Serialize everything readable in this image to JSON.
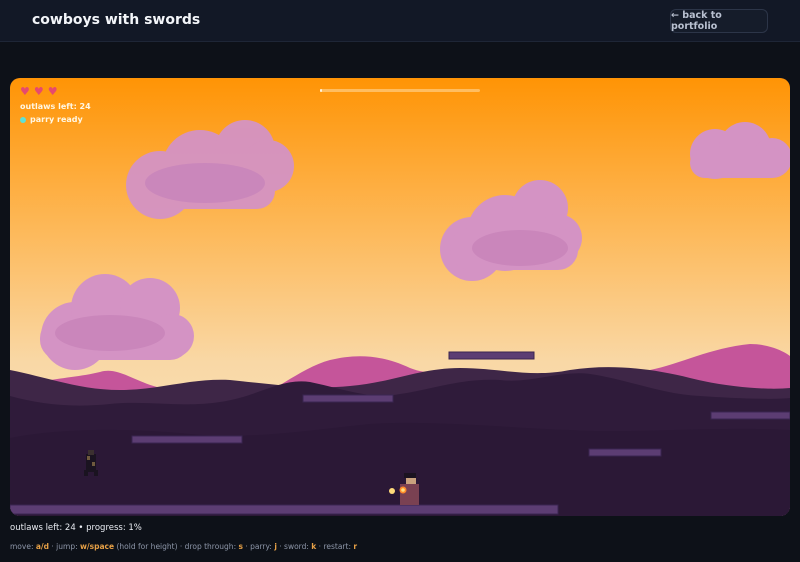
{
  "header": {
    "title": "cowboys with swords",
    "back_label": "← back to portfolio"
  },
  "hud": {
    "hearts": 3,
    "outlaws_label": "outlaws left: 24",
    "parry_label": "parry ready",
    "level_progress": 0.01
  },
  "status": {
    "text": "outlaws left: 24 • progress: 1%"
  },
  "controls": [
    {
      "label": "move: ",
      "key": "a/d",
      "note": ""
    },
    {
      "label": " · jump: ",
      "key": "w/space",
      "note": " (hold for height)"
    },
    {
      "label": " · drop through: ",
      "key": "s",
      "note": ""
    },
    {
      "label": " · parry: ",
      "key": "j",
      "note": ""
    },
    {
      "label": " · sword: ",
      "key": "k",
      "note": ""
    },
    {
      "label": " · restart: ",
      "key": "r",
      "note": ""
    }
  ],
  "colors": {
    "sky_top": "#ff9405",
    "sky_bottom": "#f7e6c2",
    "cloud": "#d493c4",
    "mountain_far": "#c5559a",
    "hill_mid": "#3e2647",
    "hill_near": "#2f1b3a",
    "platform": "#5c3d73",
    "heart": "#e64a6e",
    "parry": "#5ee1d6",
    "key_accent": "#e6a046"
  }
}
